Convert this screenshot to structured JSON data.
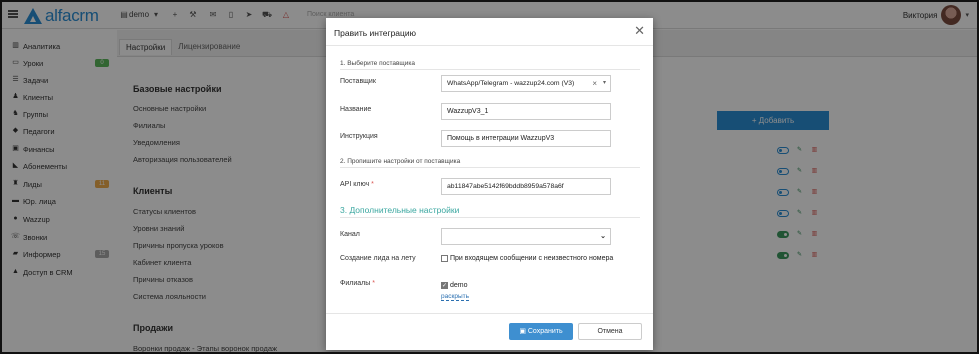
{
  "topbar": {
    "brand": "alfacrm",
    "branch": "demo",
    "search_placeholder": "Поиск клиента",
    "user_name": "Виктория"
  },
  "sidebar": {
    "items": [
      {
        "label": "Аналитика",
        "icon": "chart-icon"
      },
      {
        "label": "Уроки",
        "icon": "calendar-icon",
        "badge": "0"
      },
      {
        "label": "Задачи",
        "icon": "tasks-icon"
      },
      {
        "label": "Клиенты",
        "icon": "user-icon"
      },
      {
        "label": "Группы",
        "icon": "users-icon"
      },
      {
        "label": "Педагоги",
        "icon": "graduation-icon"
      },
      {
        "label": "Финансы",
        "icon": "money-icon"
      },
      {
        "label": "Абонементы",
        "icon": "tag-icon"
      },
      {
        "label": "Лиды",
        "icon": "leads-icon",
        "badge": "11"
      },
      {
        "label": "Юр. лица",
        "icon": "building-icon"
      },
      {
        "label": "Wazzup",
        "icon": "chat-icon"
      },
      {
        "label": "Звонки",
        "icon": "phone-icon"
      },
      {
        "label": "Информер",
        "icon": "informer-icon",
        "badge": "15"
      },
      {
        "label": "Доступ в CRM",
        "icon": "lock-icon"
      }
    ],
    "badge_colors": {
      "green": "#5cb85c",
      "orange": "#f0ad4e",
      "gray": "#aaaaaa"
    }
  },
  "main": {
    "tabs": [
      {
        "label": "Настройки"
      },
      {
        "label": "Лицензирование"
      }
    ],
    "sections": [
      {
        "title": "Базовые настройки",
        "links": [
          "Основные настройки",
          "Филиалы",
          "Уведомления",
          "Авторизация пользователей"
        ]
      },
      {
        "title": "Клиенты",
        "links": [
          "Статусы клиентов",
          "Уровни знаний",
          "Причины пропуска уроков",
          "Кабинет клиента",
          "Причины отказов",
          "Система лояльности"
        ]
      },
      {
        "title": "Продажи",
        "links": [
          "Воронки продаж - Этапы воронок продаж"
        ]
      }
    ],
    "add_button": "+ Добавить"
  },
  "modal": {
    "title": "Править интеграцию",
    "step1": "1. Выберите поставщика",
    "provider_label": "Поставщик",
    "provider_value": "WhatsApp/Telegram - wazzup24.com (V3)",
    "name_label": "Название",
    "name_value": "WazzupV3_1",
    "instruction_label": "Инструкция",
    "instruction_value": "Помощь в интеграции WazzupV3",
    "step2": "2. Пропишите настройки от поставщика",
    "api_label": "API ключ",
    "api_value": "ab11847abe5142f69bddb8959a578a6f",
    "step3": "3. Дополнительные настройки",
    "channel_label": "Канал",
    "channel_value": "",
    "lead_label": "Создание лида на лету",
    "lead_option": "При входящем сообщении с неизвестного номера",
    "branches_label": "Филиалы",
    "branch_option": "demo",
    "expand_link": "раскрыть",
    "save_label": "Сохранить",
    "cancel_label": "Отмена",
    "required_mark": "*"
  }
}
